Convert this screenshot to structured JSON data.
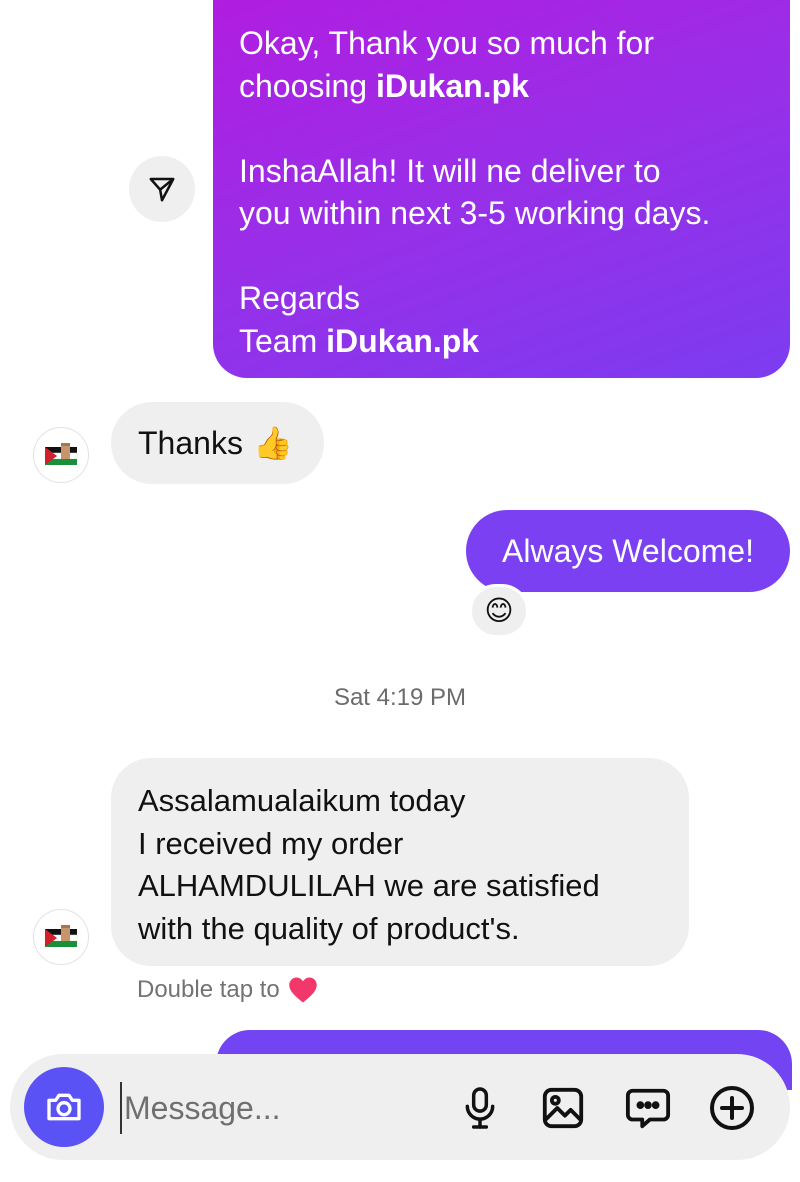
{
  "messages": {
    "outgoing_order": {
      "line1": "Okay, Thank you so much for",
      "line2_prefix": "choosing ",
      "brand": "iDukan.pk",
      "line3": "InshaAllah! It will ne deliver to",
      "line4": "you within next 3-5 working days.",
      "line5": "Regards",
      "line6_prefix": "Team ",
      "line6_brand": "iDukan.pk"
    },
    "incoming_thanks": {
      "text": "Thanks",
      "emoji": "👍"
    },
    "outgoing_welcome": {
      "text": "Always Welcome!",
      "reaction": "😊"
    },
    "timestamp": "Sat 4:19 PM",
    "incoming_review": {
      "line1": "Assalamualaikum today",
      "line2": "I received my order",
      "line3": "ALHAMDULILAH we are satisfied",
      "line4": "with the quality of product's."
    },
    "hint": {
      "text": "Double tap to",
      "emoji": "❤️"
    }
  },
  "composer": {
    "placeholder": "Message...",
    "icons": [
      "camera-icon",
      "microphone-icon",
      "gallery-icon",
      "sticker-icon",
      "plus-icon"
    ]
  },
  "colors": {
    "outgoing_gradient_start": "#b01de0",
    "outgoing_gradient_end": "#7c3cf0",
    "outgoing_solid": "#7a40f2",
    "incoming_bg": "#efefef",
    "camera_button": "#5a52f5"
  }
}
